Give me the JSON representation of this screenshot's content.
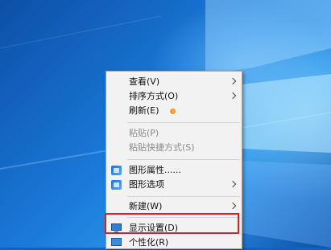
{
  "colors": {
    "desktop_blue": "#0a63c6",
    "menu_background": "#f2f2f2",
    "highlight_border": "#d8202a",
    "disabled_text": "#8a8a8a"
  },
  "context_menu": {
    "items": [
      {
        "label": "查看(V)",
        "submenu": true
      },
      {
        "label": "排序方式(O)",
        "submenu": true
      },
      {
        "label": "刷新(E)"
      },
      {
        "label": "粘贴(P)",
        "disabled": true
      },
      {
        "label": "粘贴快捷方式(S)",
        "disabled": true
      },
      {
        "label": "图形属性......",
        "icon": "graphics-icon"
      },
      {
        "label": "图形选项",
        "icon": "graphics-icon",
        "submenu": true
      },
      {
        "label": "新建(W)",
        "submenu": true
      },
      {
        "label": "显示设置(D)",
        "icon": "display-icon",
        "highlighted": true
      },
      {
        "label": "个性化(R)",
        "icon": "personalize-icon"
      }
    ]
  }
}
